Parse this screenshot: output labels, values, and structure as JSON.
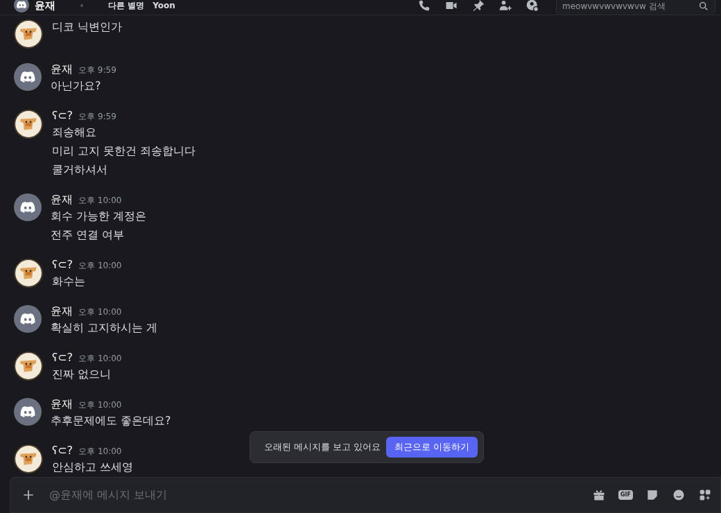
{
  "header": {
    "title": "윤재",
    "alias_label": "다른 별명",
    "alias": "Yoon",
    "search": {
      "placeholder": "meowvwvwvwvwvw 검색"
    }
  },
  "messages": [
    {
      "kind": "picture",
      "lines": [
        "디코 닉변인가"
      ]
    },
    {
      "kind": "default",
      "author": "윤재",
      "time": "오후 9:59",
      "lines": [
        "아닌가요?"
      ]
    },
    {
      "kind": "picture",
      "author": "ʕ⊂?",
      "time": "오후 9:59",
      "lines": [
        "죄송해요",
        "미리 고지 못한건 죄송합니다",
        "쿨거하셔서"
      ]
    },
    {
      "kind": "default",
      "author": "윤재",
      "time": "오후 10:00",
      "lines": [
        "회수 가능한 계정은",
        "전주 연결 여부"
      ]
    },
    {
      "kind": "picture",
      "author": "ʕ⊂?",
      "time": "오후 10:00",
      "lines": [
        "화수는"
      ]
    },
    {
      "kind": "default",
      "author": "윤재",
      "time": "오후 10:00",
      "lines": [
        "확실히 고지하시는 게"
      ]
    },
    {
      "kind": "picture",
      "author": "ʕ⊂?",
      "time": "오후 10:00",
      "lines": [
        "진짜 없으니"
      ]
    },
    {
      "kind": "default",
      "author": "윤재",
      "time": "오후 10:00",
      "lines": [
        "추후문제에도 좋은데요?"
      ]
    },
    {
      "kind": "picture",
      "author": "ʕ⊂?",
      "time": "오후 10:00",
      "lines": [
        "안심하고 쓰세영"
      ]
    }
  ],
  "jump_bar": {
    "text": "오래된 메시지를 보고 있어요",
    "button": "최근으로 이동하기"
  },
  "composer": {
    "placeholder": "@윤재에 메시지 보내기",
    "gif_label": "GIF"
  }
}
